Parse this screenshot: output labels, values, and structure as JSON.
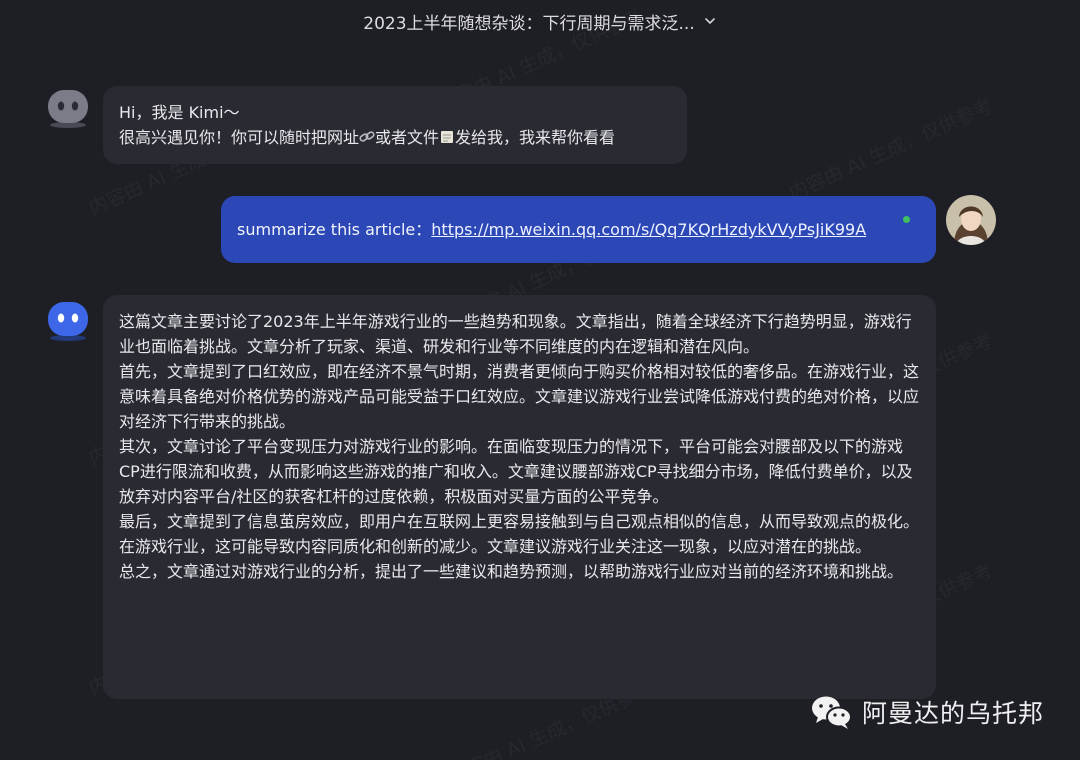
{
  "header": {
    "title": "2023上半年随想杂谈：下行周期与需求泛..."
  },
  "messages": {
    "greeting": {
      "line1": "Hi，我是 Kimi～",
      "line2_before_link_icon": "很高兴遇见你！你可以随时把网址",
      "line2_middle": "或者文件",
      "line2_end": "发给我，我来帮你看看"
    },
    "user": {
      "prefix": "summarize this article：",
      "url": "https://mp.weixin.qq.com/s/Qq7KQrHzdykVVyPsJiK99A"
    },
    "reply": {
      "paragraphs": [
        "这篇文章主要讨论了2023年上半年游戏行业的一些趋势和现象。文章指出，随着全球经济下行趋势明显，游戏行业也面临着挑战。文章分析了玩家、渠道、研发和行业等不同维度的内在逻辑和潜在风向。",
        "首先，文章提到了口红效应，即在经济不景气时期，消费者更倾向于购买价格相对较低的奢侈品。在游戏行业，这意味着具备绝对价格优势的游戏产品可能受益于口红效应。文章建议游戏行业尝试降低游戏付费的绝对价格，以应对经济下行带来的挑战。",
        "其次，文章讨论了平台变现压力对游戏行业的影响。在面临变现压力的情况下，平台可能会对腰部及以下的游戏CP进行限流和收费，从而影响这些游戏的推广和收入。文章建议腰部游戏CP寻找细分市场，降低付费单价，以及放弃对内容平台/社区的获客杠杆的过度依赖，积极面对买量方面的公平竞争。",
        "最后，文章提到了信息茧房效应，即用户在互联网上更容易接触到与自己观点相似的信息，从而导致观点的极化。在游戏行业，这可能导致内容同质化和创新的减少。文章建议游戏行业关注这一现象，以应对潜在的挑战。",
        "总之，文章通过对游戏行业的分析，提出了一些建议和趋势预测，以帮助游戏行业应对当前的经济环境和挑战。"
      ]
    }
  },
  "watermark": {
    "text": "内容由 AI 生成，仅供参考"
  },
  "brand": {
    "name": "阿曼达的乌托邦",
    "icon": "wechat-icon"
  },
  "colors": {
    "background": "#1e1e25",
    "bubble": "#2a2a33",
    "user_bubble": "#2c48b6",
    "online": "#3fbf5f"
  }
}
